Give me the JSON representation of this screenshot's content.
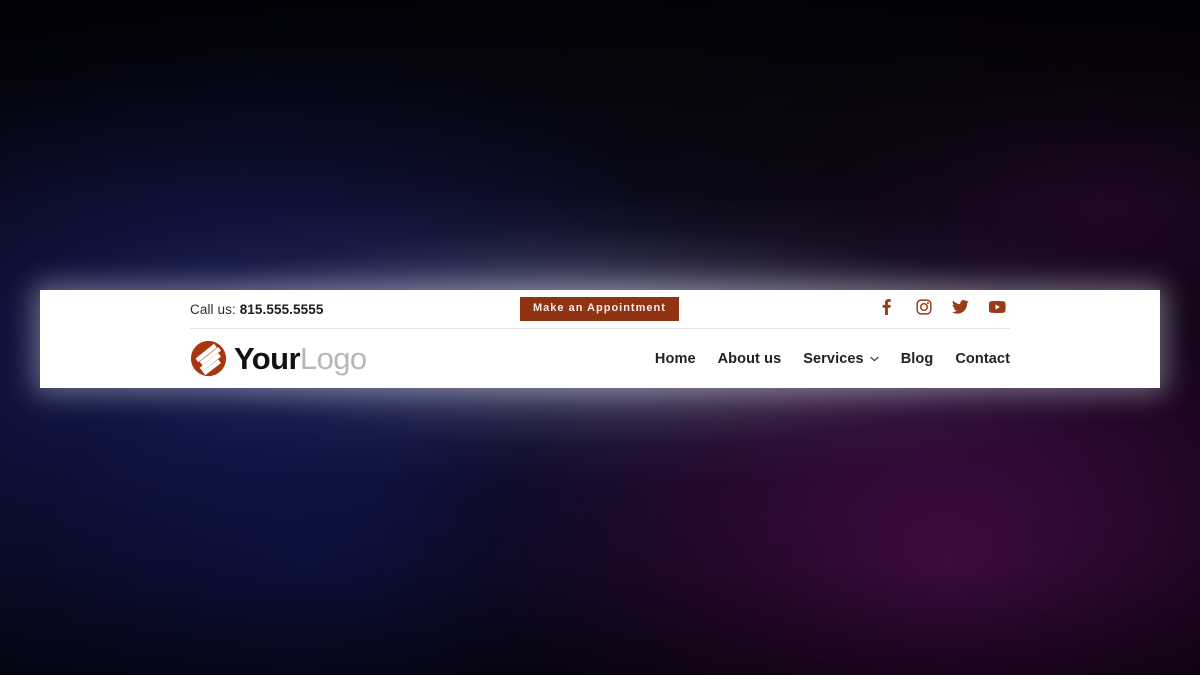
{
  "page": {
    "background_colors": {
      "navy_glow": "#1a2060",
      "purple_glow": "#520e56",
      "base_dark": "#05050c"
    }
  },
  "header": {
    "card_background": "#ffffff",
    "accent_color": "#8f3313",
    "social_icon_color": "#9a3a17",
    "utility": {
      "call_label": "Call us:",
      "call_number": "815.555.5555",
      "appointment_button": "Make an Appointment",
      "social_links": [
        {
          "name": "facebook",
          "icon": "facebook-icon",
          "label": "Facebook"
        },
        {
          "name": "instagram",
          "icon": "instagram-icon",
          "label": "Instagram"
        },
        {
          "name": "twitter",
          "icon": "twitter-icon",
          "label": "Twitter"
        },
        {
          "name": "youtube",
          "icon": "youtube-icon",
          "label": "YouTube"
        }
      ]
    },
    "brand": {
      "mark_icon": "logo-mark-icon",
      "name_bold": "Your",
      "name_light": "Logo"
    },
    "nav": {
      "items": [
        {
          "label": "Home",
          "has_dropdown": false
        },
        {
          "label": "About us",
          "has_dropdown": false
        },
        {
          "label": "Services",
          "has_dropdown": true
        },
        {
          "label": "Blog",
          "has_dropdown": false
        },
        {
          "label": "Contact",
          "has_dropdown": false
        }
      ]
    }
  }
}
